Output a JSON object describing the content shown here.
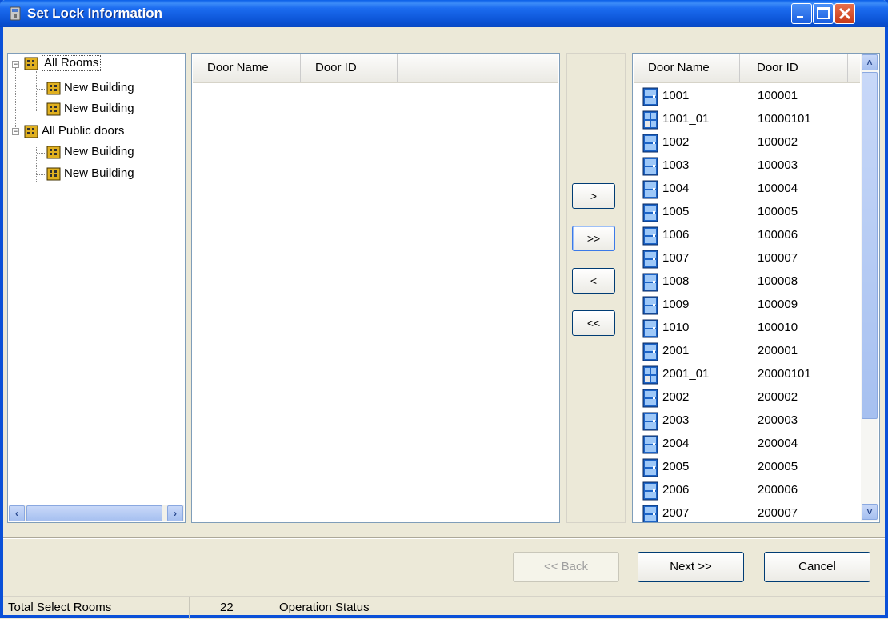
{
  "window": {
    "title": "Set Lock Information"
  },
  "tree": {
    "nodes": [
      {
        "label": "All Rooms",
        "level": 0
      },
      {
        "label": "New Building",
        "level": 1
      },
      {
        "label": "New Building",
        "level": 1
      },
      {
        "label": "All Public doors",
        "level": 0
      },
      {
        "label": "New Building",
        "level": 1
      },
      {
        "label": "New Building",
        "level": 1
      }
    ]
  },
  "selected_list": {
    "columns": [
      "Door Name",
      "Door ID"
    ],
    "rows": []
  },
  "transfer_buttons": {
    "add_one": ">",
    "add_all": ">>",
    "remove_one": "<",
    "remove_all": "<<"
  },
  "available_list": {
    "columns": [
      "Door Name",
      "Door ID"
    ],
    "rows": [
      {
        "name": "1001",
        "id": "100001",
        "icon": "door-icon"
      },
      {
        "name": "1001_01",
        "id": "10000101",
        "icon": "door-sub-icon"
      },
      {
        "name": "1002",
        "id": "100002",
        "icon": "door-icon"
      },
      {
        "name": "1003",
        "id": "100003",
        "icon": "door-icon"
      },
      {
        "name": "1004",
        "id": "100004",
        "icon": "door-icon"
      },
      {
        "name": "1005",
        "id": "100005",
        "icon": "door-icon"
      },
      {
        "name": "1006",
        "id": "100006",
        "icon": "door-icon"
      },
      {
        "name": "1007",
        "id": "100007",
        "icon": "door-icon"
      },
      {
        "name": "1008",
        "id": "100008",
        "icon": "door-icon"
      },
      {
        "name": "1009",
        "id": "100009",
        "icon": "door-icon"
      },
      {
        "name": "1010",
        "id": "100010",
        "icon": "door-icon"
      },
      {
        "name": "2001",
        "id": "200001",
        "icon": "door-icon"
      },
      {
        "name": "2001_01",
        "id": "20000101",
        "icon": "door-sub-icon"
      },
      {
        "name": "2002",
        "id": "200002",
        "icon": "door-icon"
      },
      {
        "name": "2003",
        "id": "200003",
        "icon": "door-icon"
      },
      {
        "name": "2004",
        "id": "200004",
        "icon": "door-icon"
      },
      {
        "name": "2005",
        "id": "200005",
        "icon": "door-icon"
      },
      {
        "name": "2006",
        "id": "200006",
        "icon": "door-icon"
      },
      {
        "name": "2007",
        "id": "200007",
        "icon": "door-icon"
      }
    ]
  },
  "buttons": {
    "back": "<< Back",
    "next": "Next >>",
    "cancel": "Cancel"
  },
  "status_bar": {
    "label": "Total Select Rooms",
    "count": "22",
    "operation": "Operation Status"
  },
  "colors": {
    "titlebar": "#0a52d4",
    "door_icon": "#1c64c8"
  }
}
